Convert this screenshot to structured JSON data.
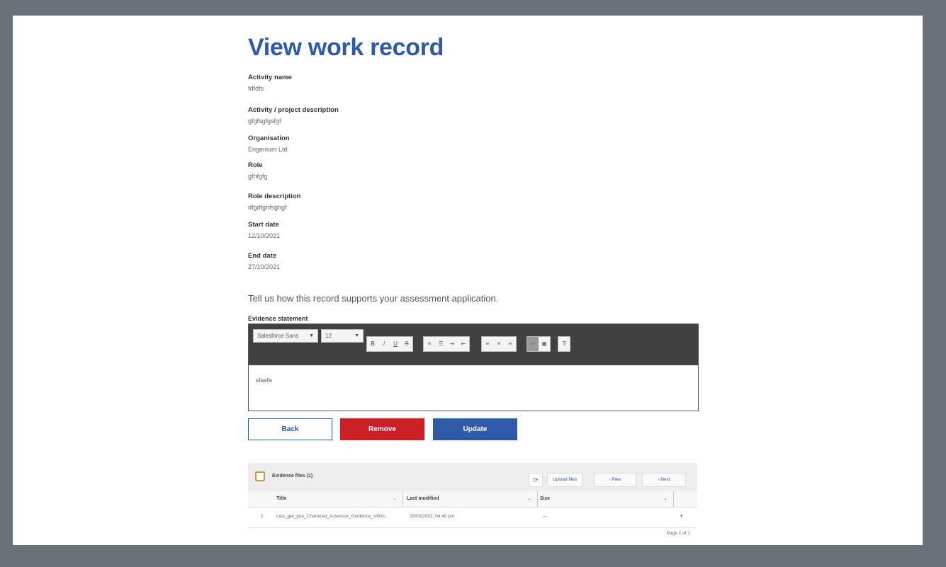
{
  "page": {
    "title": "View work record",
    "fields": [
      {
        "label": "Activity name",
        "value": "fdfdfs"
      },
      {
        "label": "Activity / project description",
        "value": "gfgfsgfgsfgf"
      },
      {
        "label": "Organisation",
        "value": "Engenium Ltd"
      },
      {
        "label": "Role",
        "value": "gfhfgfg"
      },
      {
        "label": "Role description",
        "value": "dfgdfghfsghgf"
      },
      {
        "label": "Start date",
        "value": "12/10/2021"
      },
      {
        "label": "End date",
        "value": "27/10/2021"
      }
    ],
    "prompt": "Tell us how this record supports your assessment application.",
    "evidence_label": "Evidence statement"
  },
  "editor": {
    "font_family": "Salesforce Sans",
    "font_size": "12",
    "content": "sfasfa"
  },
  "buttons": {
    "back": "Back",
    "remove": "Remove",
    "update": "Update"
  },
  "files": {
    "title": "Evidence files (1)",
    "upload_label": "Upload files",
    "prev_label": "Prev",
    "next_label": "Next",
    "columns": [
      "Title",
      "Last modified",
      "Size"
    ],
    "rows": [
      {
        "num": "1",
        "title": "Lets_get_you_Chartered_Assessor_Guidance_V6Gc...",
        "modified": "28/03/2022, 04:40 pm",
        "size": "—"
      }
    ],
    "pager": "Page 1 of 1"
  },
  "colors": {
    "title_blue": "#2f5aa8",
    "remove_red": "#cc2027",
    "toolbar_dark": "#414141",
    "frame_gray": "#6b7178"
  }
}
